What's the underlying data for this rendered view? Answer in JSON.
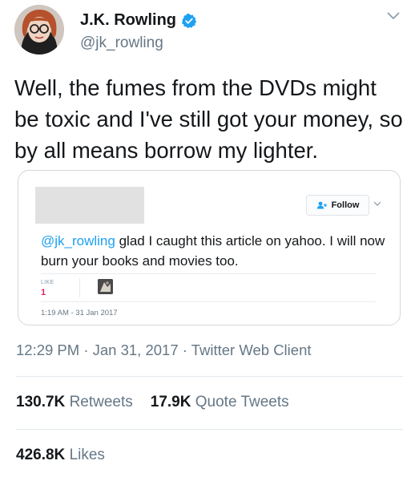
{
  "author": {
    "name": "J.K. Rowling",
    "handle": "@jk_rowling",
    "avatar_icon": "avatar-woman-glasses",
    "verified_icon": "verified-badge-icon",
    "caret_icon": "chevron-down-icon"
  },
  "tweet": {
    "text": "Well, the fumes from the DVDs might be toxic and I've still got your money, so by all means borrow my lighter."
  },
  "quoted_tweet": {
    "follow_label": "Follow",
    "mention": "@jk_rowling",
    "text": " glad I caught this article on yahoo. I will now burn your books and movies too.",
    "like_label": "LIKE",
    "like_count": "1",
    "timestamp": "1:19 AM - 31 Jan 2017"
  },
  "meta": {
    "time": "12:29 PM",
    "sep1": " · ",
    "date": "Jan 31, 2017",
    "sep2": " · ",
    "client": "Twitter Web Client"
  },
  "stats": {
    "retweets_count": "130.7K",
    "retweets_label": "Retweets",
    "quotes_count": "17.9K",
    "quotes_label": "Quote Tweets",
    "likes_count": "426.8K",
    "likes_label": "Likes"
  },
  "colors": {
    "link": "#1da1f2",
    "secondary_text": "#657786",
    "like_red": "#e0245e"
  }
}
